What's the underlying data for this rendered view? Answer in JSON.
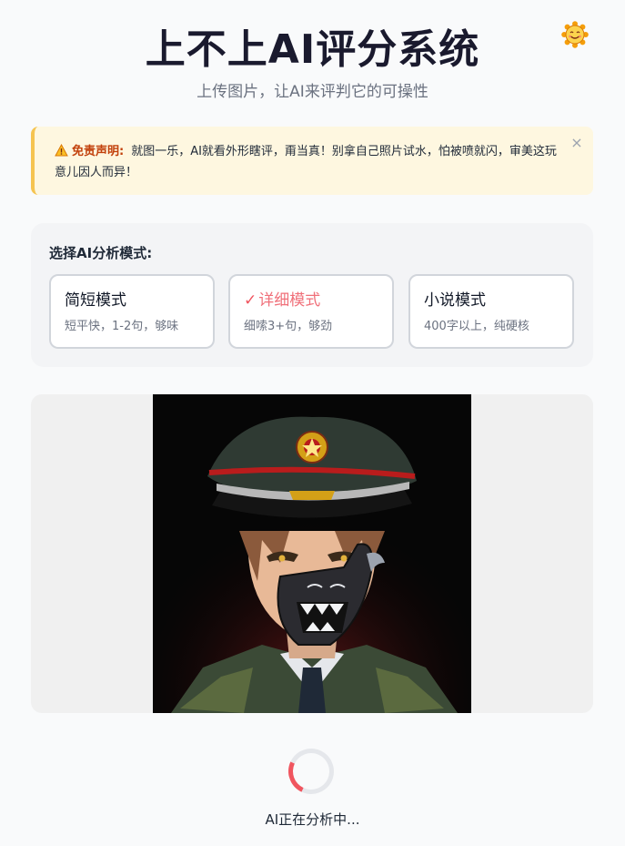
{
  "header": {
    "title": "上不上AI评分系统",
    "subtitle": "上传图片，让AI来评判它的可操性",
    "theme_toggle_icon": "smiley-sun-icon"
  },
  "disclaimer": {
    "icon": "warning-icon",
    "label": "免责声明:",
    "text": "就图一乐，AI就看外形瞎评，甭当真！别拿自己照片试水，怕被喷就闪，审美这玩意儿因人而异！",
    "close_label": "×"
  },
  "modes": {
    "heading": "选择AI分析模式:",
    "selected": "detailed",
    "items": [
      {
        "id": "short",
        "name": "简短模式",
        "desc": "短平快，1-2句，够味"
      },
      {
        "id": "detailed",
        "name": "详细模式",
        "desc": "细嗦3+句，够劲",
        "check": "✓"
      },
      {
        "id": "novel",
        "name": "小说模式",
        "desc": "400字以上，纯硬核"
      }
    ]
  },
  "preview": {
    "image_subject": "anime-soldier-portrait"
  },
  "analysis": {
    "status": "AI正在分析中..."
  },
  "colors": {
    "accent": "#f0555f",
    "warning_border": "#f5c451",
    "warning_bg": "#fef7e0",
    "disclaimer_label": "#c2410c"
  }
}
